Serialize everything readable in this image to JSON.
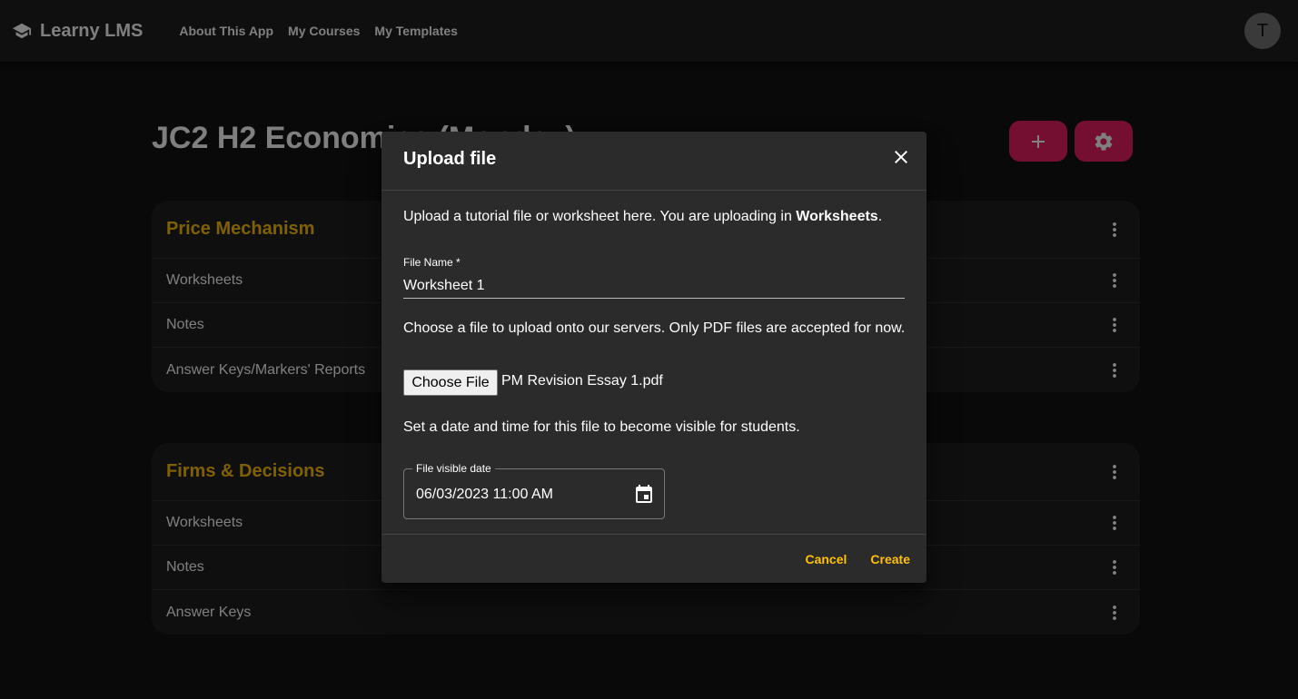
{
  "app": {
    "title": "Learny LMS",
    "nav": [
      "About This App",
      "My Courses",
      "My Templates"
    ],
    "avatar_initial": "T"
  },
  "course": {
    "title": "JC2 H2 Economics (Monday)"
  },
  "topics": [
    {
      "title": "Price Mechanism",
      "items": [
        "Worksheets",
        "Notes",
        "Answer Keys/Markers' Reports"
      ]
    },
    {
      "title": "Firms & Decisions",
      "items": [
        "Worksheets",
        "Notes",
        "Answer Keys"
      ]
    }
  ],
  "dialog": {
    "title": "Upload file",
    "desc_prefix": "Upload a tutorial file or worksheet here. You are uploading in",
    "desc_category": "Worksheets",
    "desc_suffix": ".",
    "file_name_label": "File Name *",
    "file_name_value": "Worksheet 1",
    "upload_desc": "Choose a file to upload onto our servers. Only PDF files are accepted for now.",
    "choose_file_label": "Choose File",
    "chosen_file_name": "PM Revision Essay 1.pdf",
    "date_desc": "Set a date and time for this file to become visible for students.",
    "date_label": "File visible date",
    "date_value": "06/03/2023 11:00 AM",
    "cancel_label": "Cancel",
    "create_label": "Create"
  },
  "colors": {
    "accent": "#ffc107",
    "fab": "#e91e63",
    "appbar": "#1e1e1e",
    "background": "#121212",
    "dialog": "#2b2b2b"
  },
  "icons": {
    "brand": "graduation-cap-icon",
    "add": "plus-icon",
    "settings": "gear-icon",
    "menu": "more-vert-icon",
    "close": "close-icon",
    "calendar": "calendar-icon"
  }
}
